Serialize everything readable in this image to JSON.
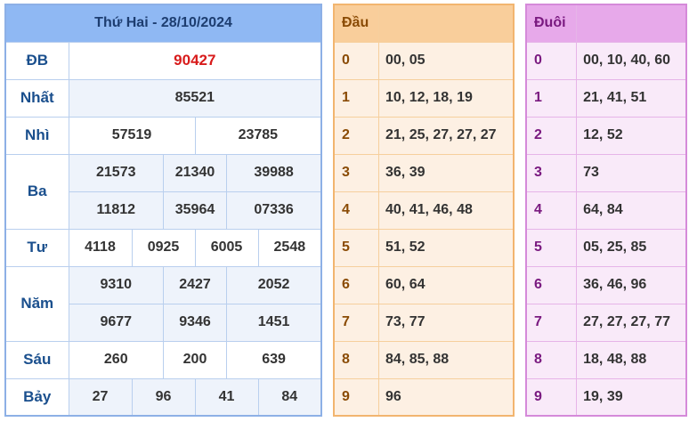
{
  "results": {
    "title": "Thứ Hai - 28/10/2024",
    "prizes": [
      {
        "label": "ĐB",
        "values": [
          "90427"
        ]
      },
      {
        "label": "Nhất",
        "values": [
          "85521"
        ]
      },
      {
        "label": "Nhì",
        "values": [
          "57519",
          "23785"
        ]
      },
      {
        "label": "Ba",
        "values": [
          "21573",
          "21340",
          "39988",
          "11812",
          "35964",
          "07336"
        ]
      },
      {
        "label": "Tư",
        "values": [
          "4118",
          "0925",
          "6005",
          "2548"
        ]
      },
      {
        "label": "Năm",
        "values": [
          "9310",
          "2427",
          "2052",
          "9677",
          "9346",
          "1451"
        ]
      },
      {
        "label": "Sáu",
        "values": [
          "260",
          "200",
          "639"
        ]
      },
      {
        "label": "Bảy",
        "values": [
          "27",
          "96",
          "41",
          "84"
        ]
      }
    ]
  },
  "dau": {
    "header": "Đầu",
    "rows": [
      {
        "key": "0",
        "value": "00, 05"
      },
      {
        "key": "1",
        "value": "10, 12, 18, 19"
      },
      {
        "key": "2",
        "value": "21, 25, 27, 27, 27"
      },
      {
        "key": "3",
        "value": "36, 39"
      },
      {
        "key": "4",
        "value": "40, 41, 46, 48"
      },
      {
        "key": "5",
        "value": "51, 52"
      },
      {
        "key": "6",
        "value": "60, 64"
      },
      {
        "key": "7",
        "value": "73, 77"
      },
      {
        "key": "8",
        "value": "84, 85, 88"
      },
      {
        "key": "9",
        "value": "96"
      }
    ]
  },
  "duoi": {
    "header": "Đuôi",
    "rows": [
      {
        "key": "0",
        "value": "00, 10, 40, 60"
      },
      {
        "key": "1",
        "value": "21, 41, 51"
      },
      {
        "key": "2",
        "value": "12, 52"
      },
      {
        "key": "3",
        "value": "73"
      },
      {
        "key": "4",
        "value": "64, 84"
      },
      {
        "key": "5",
        "value": "05, 25, 85"
      },
      {
        "key": "6",
        "value": "36, 46, 96"
      },
      {
        "key": "7",
        "value": "27, 27, 27, 77"
      },
      {
        "key": "8",
        "value": "18, 48, 88"
      },
      {
        "key": "9",
        "value": "19, 39"
      }
    ]
  },
  "colors": {
    "special_prize": "#d81b1b",
    "results_header": "#8fb8f3",
    "dau_header": "#f9ce9b",
    "duoi_header": "#e7a9ea"
  }
}
